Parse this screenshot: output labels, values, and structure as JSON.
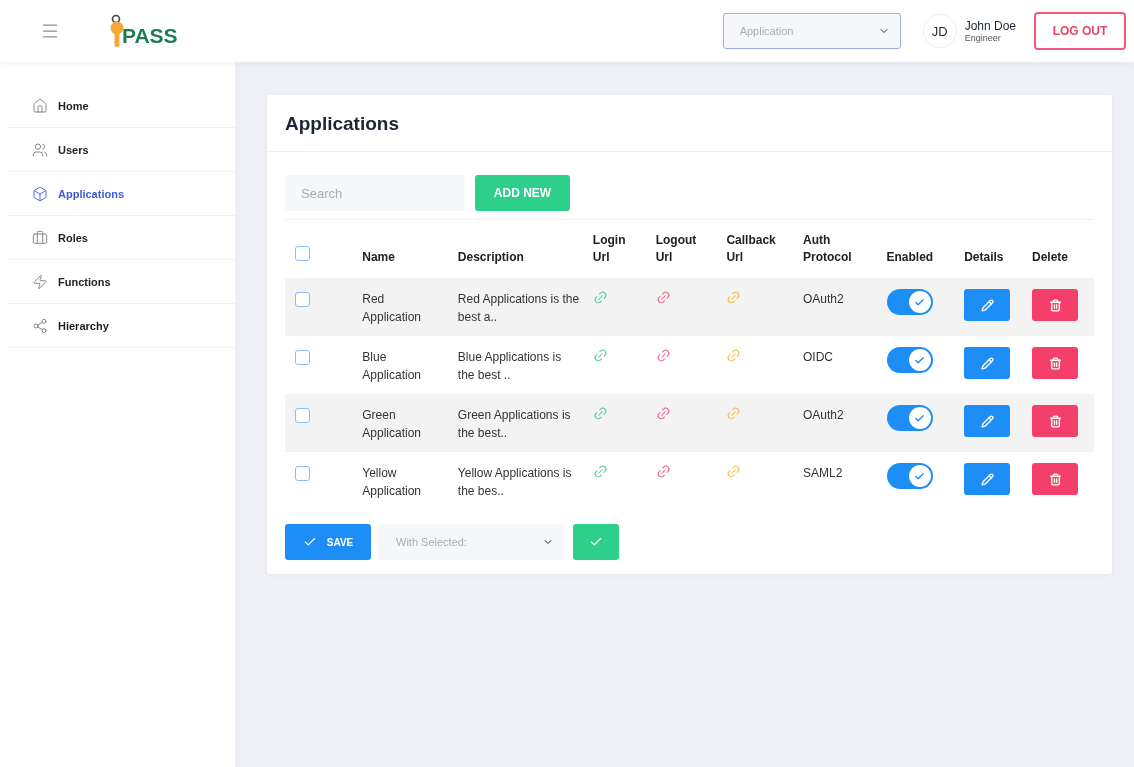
{
  "header": {
    "logo_text": "PASS",
    "app_select": {
      "placeholder": "Application"
    },
    "user": {
      "initials": "JD",
      "name": "John Doe",
      "role": "Engineer"
    },
    "logout": "LOG OUT"
  },
  "sidebar": {
    "items": [
      {
        "label": "Home",
        "selected": false
      },
      {
        "label": "Users",
        "selected": false
      },
      {
        "label": "Applications",
        "selected": true
      },
      {
        "label": "Roles",
        "selected": false
      },
      {
        "label": "Functions",
        "selected": false
      },
      {
        "label": "Hierarchy",
        "selected": false
      }
    ]
  },
  "page": {
    "title": "Applications",
    "search": {
      "placeholder": "Search"
    },
    "add_button": "ADD NEW"
  },
  "table": {
    "all_checked": false,
    "columns": [
      "Name",
      "Description",
      "Login Url",
      "Logout Url",
      "Callback Url",
      "Auth Protocol",
      "Enabled",
      "Details",
      "Delete"
    ],
    "rows": [
      {
        "checked": false,
        "name": "Red Application",
        "description": "Red Applications is the best a..",
        "protocol": "OAuth2",
        "enabled": true
      },
      {
        "checked": false,
        "name": "Blue Application",
        "description": "Blue Applications is the best ..",
        "protocol": "OIDC",
        "enabled": true
      },
      {
        "checked": false,
        "name": "Green Application",
        "description": "Green Applications is the best..",
        "protocol": "OAuth2",
        "enabled": true
      },
      {
        "checked": false,
        "name": "Yellow Application",
        "description": "Yellow Applications is the bes..",
        "protocol": "SAML2",
        "enabled": true
      }
    ]
  },
  "footer": {
    "save": "SAVE",
    "bulk_select": {
      "placeholder": "With Selected:"
    }
  }
}
